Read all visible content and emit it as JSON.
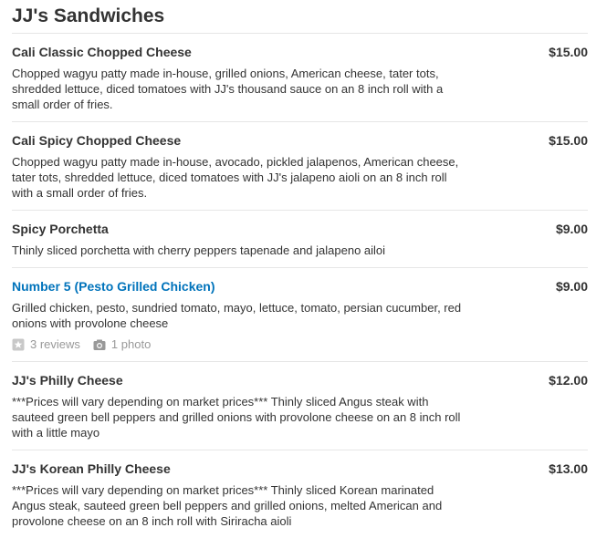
{
  "section": {
    "title": "JJ's Sandwiches"
  },
  "items": [
    {
      "name": "Cali Classic Chopped Cheese",
      "price": "$15.00",
      "description": "Chopped wagyu patty made in-house, grilled onions, American cheese, tater tots, shredded lettuce, diced tomatoes with JJ's thousand sauce on an 8 inch roll with a small order of fries."
    },
    {
      "name": "Cali Spicy Chopped Cheese",
      "price": "$15.00",
      "description": "Chopped wagyu patty made in-house, avocado, pickled jalapenos, American cheese, tater tots, shredded lettuce, diced tomatoes with JJ's jalapeno aioli on an 8 inch roll with a small order of fries."
    },
    {
      "name": "Spicy Porchetta",
      "price": "$9.00",
      "description": "Thinly sliced porchetta with cherry peppers tapenade and jalapeno ailoi"
    },
    {
      "name": "Number 5 (Pesto Grilled Chicken)",
      "price": "$9.00",
      "description": "Grilled chicken, pesto, sundried tomato, mayo, lettuce, tomato, persian cucumber, red onions with provolone cheese",
      "reviews": "3 reviews",
      "photos": "1 photo",
      "link_color": "#0073bb"
    },
    {
      "name": "JJ's Philly Cheese",
      "price": "$12.00",
      "description": "***Prices will vary depending on market prices*** Thinly sliced Angus steak with sauteed green bell peppers and grilled onions with provolone cheese on an 8 inch roll with a little mayo"
    },
    {
      "name": "JJ's Korean Philly Cheese",
      "price": "$13.00",
      "description": "***Prices will vary depending on market prices*** Thinly sliced Korean marinated Angus steak, sauteed green bell peppers and grilled onions, melted American and provolone cheese on an 8 inch roll with Siriracha aioli"
    }
  ],
  "icons": {
    "review": "star-icon",
    "photo": "camera-icon"
  }
}
